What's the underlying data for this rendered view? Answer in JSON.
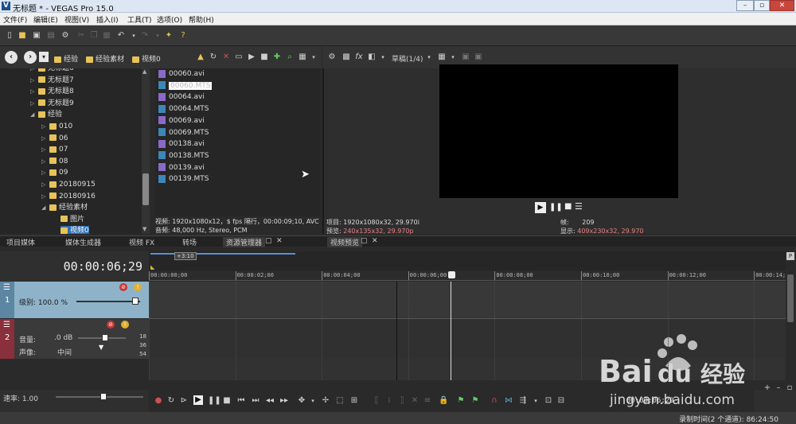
{
  "app": {
    "title": "无标题 * - VEGAS Pro 15.0",
    "icon_letter": "V"
  },
  "window_controls": [
    "minimize-icon",
    "maximize-icon",
    "close-icon"
  ],
  "menu": [
    "文件(F)",
    "编辑(E)",
    "视图(V)",
    "插入(I)",
    "工具(T)",
    "选项(O)",
    "帮助(H)"
  ],
  "explorer": {
    "breadcrumbs": [
      "经验",
      "经验素材",
      "视频0"
    ],
    "tree": [
      {
        "label": "无标题6",
        "level": 1
      },
      {
        "label": "无标题7",
        "level": 1
      },
      {
        "label": "无标题8",
        "level": 1
      },
      {
        "label": "无标题9",
        "level": 1
      },
      {
        "label": "经验",
        "level": 1,
        "expanded": true
      },
      {
        "label": "010",
        "level": 2
      },
      {
        "label": "06",
        "level": 2
      },
      {
        "label": "07",
        "level": 2
      },
      {
        "label": "08",
        "level": 2
      },
      {
        "label": "09",
        "level": 2
      },
      {
        "label": "20180915",
        "level": 2
      },
      {
        "label": "20180916",
        "level": 2
      },
      {
        "label": "经验素材",
        "level": 2,
        "expanded": true
      },
      {
        "label": "图片",
        "level": 3
      },
      {
        "label": "视频0",
        "level": 3,
        "selected": true
      }
    ],
    "files": [
      {
        "name": "00060.avi",
        "type": "avi"
      },
      {
        "name": "00060.MTS",
        "type": "mts",
        "selected": true
      },
      {
        "name": "00064.avi",
        "type": "avi"
      },
      {
        "name": "00064.MTS",
        "type": "mts"
      },
      {
        "name": "00069.avi",
        "type": "avi"
      },
      {
        "name": "00069.MTS",
        "type": "mts"
      },
      {
        "name": "00138.avi",
        "type": "avi"
      },
      {
        "name": "00138.MTS",
        "type": "mts"
      },
      {
        "name": "00139.avi",
        "type": "avi"
      },
      {
        "name": "00139.MTS",
        "type": "mts"
      }
    ],
    "info_video": "视频: 1920x1080x12，$ fps 隔行，00:00:09;10, AVC",
    "info_audio": "音频: 48,000 Hz, Stereo, PCM",
    "tabs": [
      "项目媒体",
      "媒体生成器",
      "视频 FX",
      "转场",
      "资源管理器"
    ]
  },
  "preview": {
    "quality": "草稿(1/4)",
    "project_label": "项目:",
    "project_value": "1920x1080x32, 29.970i",
    "preview_label": "预览:",
    "preview_value": "240x135x32, 29.970p",
    "frame_label": "帧:",
    "frame_value": "209",
    "display_label": "显示:",
    "display_value": "409x230x32, 29.970",
    "tab": "视频预览"
  },
  "timeline": {
    "timecode": "00:00:06;29",
    "region_label": "+3:10",
    "ruler": [
      "00:00:00;00",
      "00:00:02;00",
      "00:00:04;00",
      "00:00:06;00",
      "00:00:08;00",
      "00:00:10;00",
      "00:00:12;00",
      "00:00:14;0"
    ],
    "track1": {
      "num": "1",
      "level_label": "级别: 100.0 %"
    },
    "track2": {
      "num": "2",
      "vol_label": "音量:",
      "vol_value": ".0 dB",
      "pan_label": "声像:",
      "pan_value": "中间",
      "meter": [
        "18",
        "36",
        "54"
      ]
    },
    "rate_label": "速率: 1.00",
    "end_time": "00:00:06;29"
  },
  "status": {
    "record_time": "录制时间(2 个通道): 86:24:50"
  },
  "watermark": {
    "text": "Baidu经验",
    "url": "jingyan.baidu.com"
  }
}
